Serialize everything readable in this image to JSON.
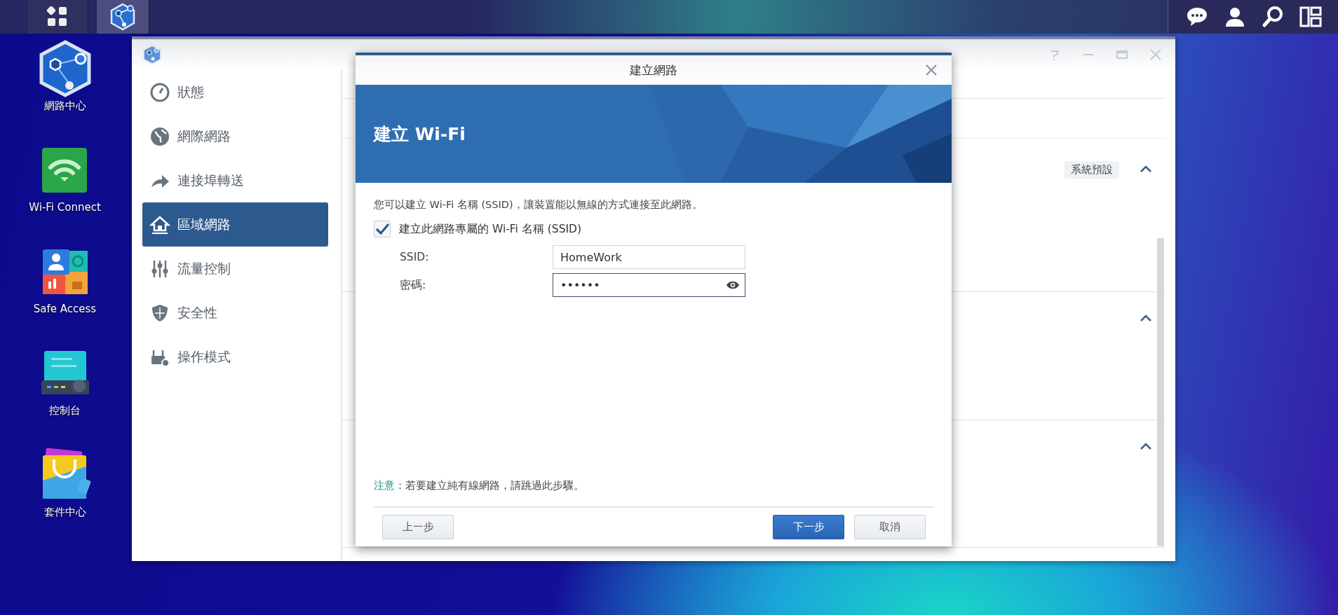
{
  "desktop_icons": [
    {
      "label": "網路中心"
    },
    {
      "label": "Wi-Fi Connect"
    },
    {
      "label": "Safe Access"
    },
    {
      "label": "控制台"
    },
    {
      "label": "套件中心"
    }
  ],
  "sidebar": {
    "items": [
      {
        "label": "狀態",
        "selected": false
      },
      {
        "label": "網際網路",
        "selected": false
      },
      {
        "label": "連接埠轉送",
        "selected": false
      },
      {
        "label": "區域網路",
        "selected": true
      },
      {
        "label": "流量控制",
        "selected": false
      },
      {
        "label": "安全性",
        "selected": false
      },
      {
        "label": "操作模式",
        "selected": false
      }
    ]
  },
  "background_panel": {
    "badge": "系統預設"
  },
  "dialog": {
    "title": "建立網路",
    "banner_title": "建立 Wi-Fi",
    "description": "您可以建立 Wi-Fi 名稱 (SSID)，讓裝置能以無線的方式連接至此網路。",
    "checkbox": {
      "label": "建立此網路專屬的 Wi-Fi 名稱 (SSID)",
      "checked": true
    },
    "fields": [
      {
        "label": "SSID:",
        "value": "HomeWork",
        "kind": "text"
      },
      {
        "label": "密碼:",
        "value": "••••••",
        "kind": "password"
      }
    ],
    "note_label": "注意",
    "note_text": "：若要建立純有線網路，請跳過此步驟。",
    "buttons": [
      {
        "label": "上一步",
        "kind": "secondary"
      },
      {
        "label": "下一步",
        "kind": "primary"
      },
      {
        "label": "取消",
        "kind": "secondary"
      }
    ]
  }
}
